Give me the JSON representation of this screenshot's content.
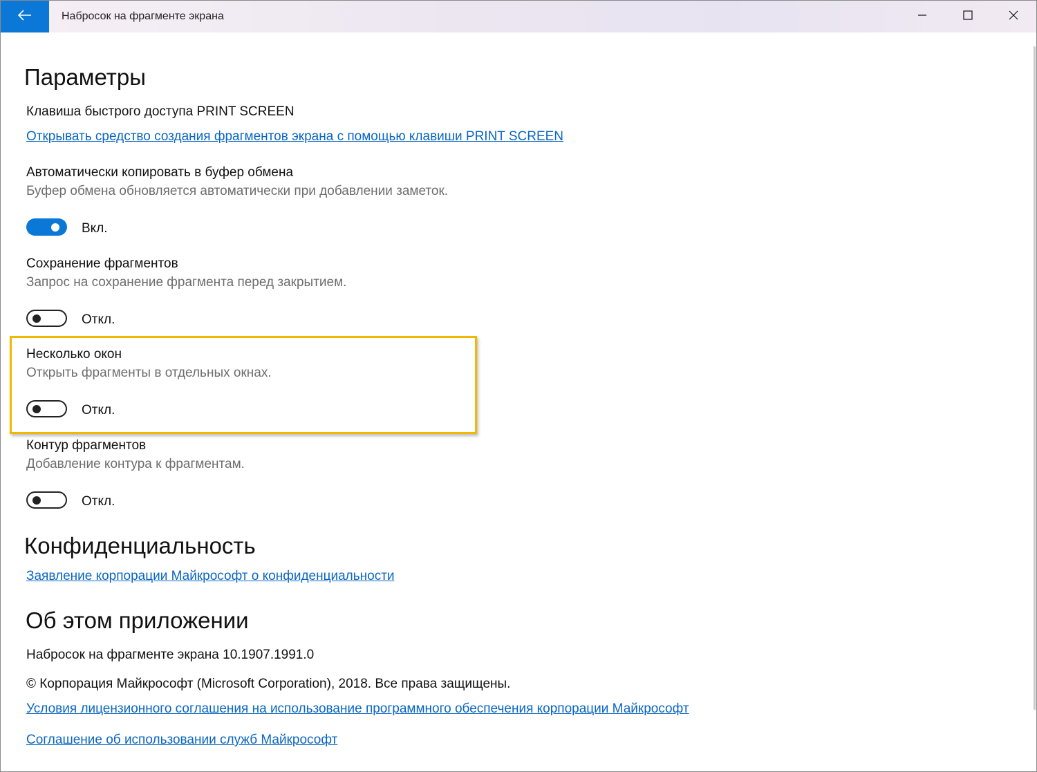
{
  "window": {
    "title": "Набросок на фрагменте экрана",
    "accent_color": "#0b78d7",
    "controls": [
      "back-arrow-icon",
      "minimize-icon",
      "maximize-icon",
      "close-icon"
    ]
  },
  "settings": {
    "heading": "Параметры",
    "print_screen": {
      "label": "Клавиша быстрого доступа PRINT SCREEN",
      "link": "Открывать средство создания фрагментов экрана с помощью клавиши PRINT SCREEN"
    },
    "auto_copy": {
      "label": "Автоматически копировать в буфер обмена",
      "description": "Буфер обмена обновляется автоматически при добавлении заметок.",
      "state": "on",
      "state_label": "Вкл."
    },
    "save_snips": {
      "label": "Сохранение фрагментов",
      "description": "Запрос на сохранение фрагмента перед закрытием.",
      "state": "off",
      "state_label": "Откл."
    },
    "multiple_windows": {
      "label": "Несколько окон",
      "description": "Открыть фрагменты в отдельных окнах.",
      "state": "off",
      "state_label": "Откл.",
      "highlight_color": "#f2b800"
    },
    "snip_outline": {
      "label": "Контур фрагментов",
      "description": "Добавление контура к фрагментам.",
      "state": "off",
      "state_label": "Откл."
    }
  },
  "privacy": {
    "heading": "Конфиденциальность",
    "link": "Заявление корпорации Майкрософт о конфиденциальности"
  },
  "about": {
    "heading": "Об этом приложении",
    "version": "Набросок на фрагменте экрана 10.1907.1991.0",
    "copyright": "© Корпорация Майкрософт (Microsoft Corporation), 2018. Все права защищены.",
    "license_link": "Условия лицензионного соглашения на использование программного обеспечения корпорации Майкрософт",
    "services_link": "Соглашение об использовании служб Майкрософт"
  }
}
